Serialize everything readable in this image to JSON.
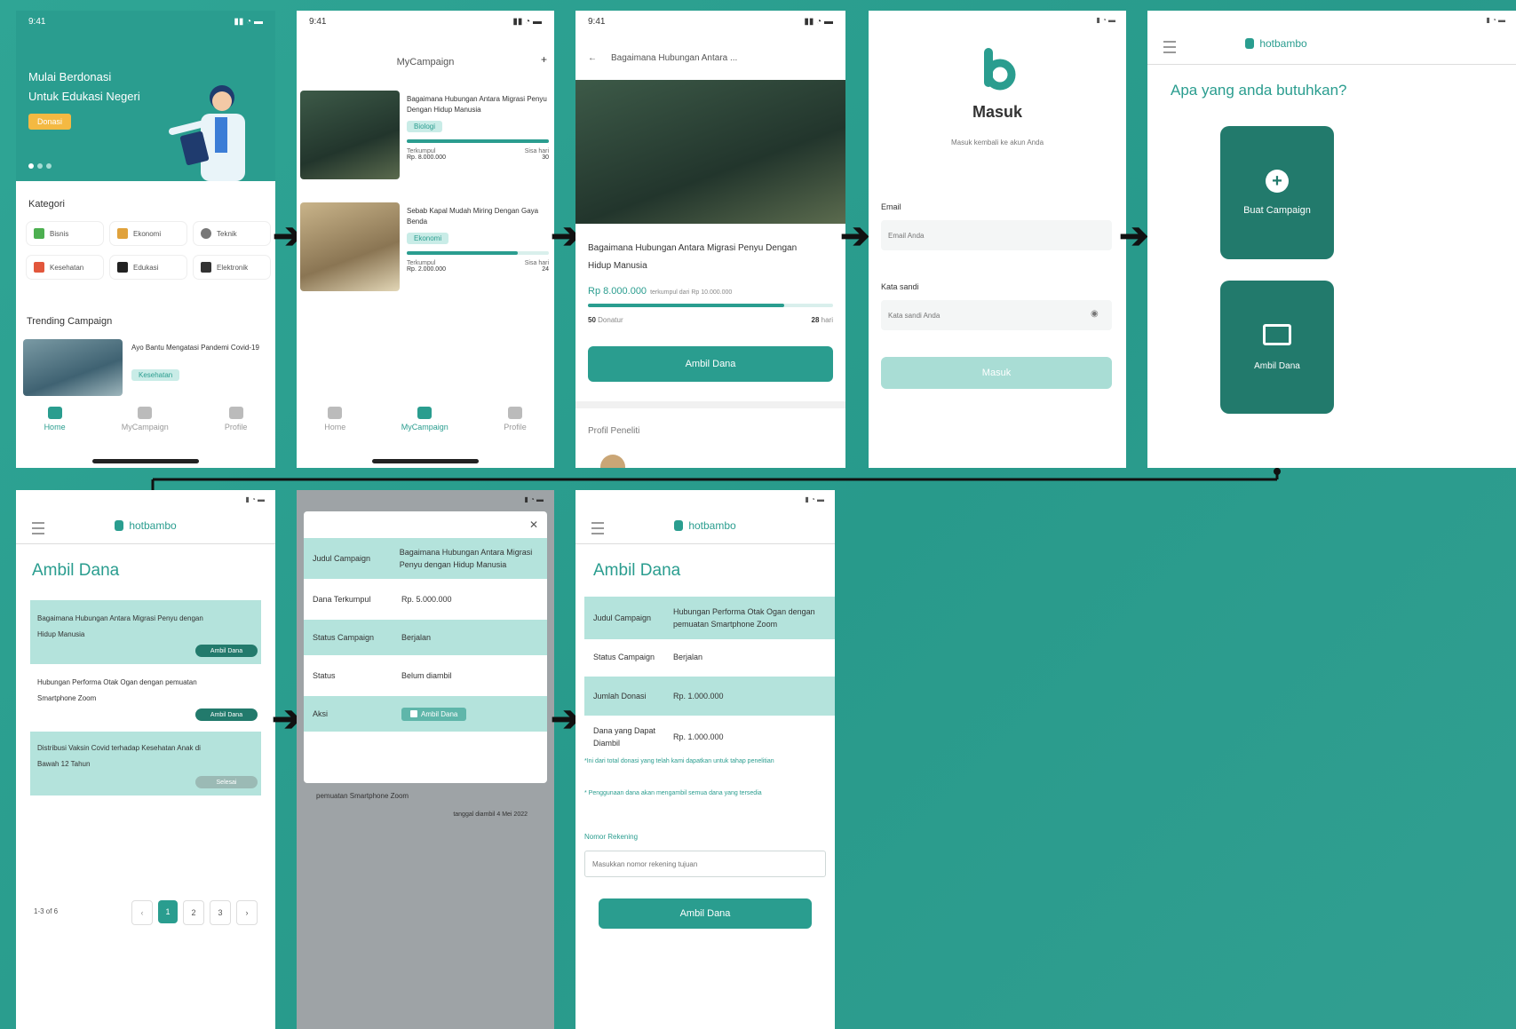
{
  "colors": {
    "primary": "#2a9d8f",
    "light": "#b4e3dc",
    "accent": "#f4b942",
    "bg": "#2a9d8f"
  },
  "s1": {
    "status_time": "9:41",
    "banner_title_1": "Mulai Berdonasi",
    "banner_title_2": "Untuk Edukasi Negeri",
    "banner_button": "Donasi",
    "kategori_title": "Kategori",
    "categories": [
      "Bisnis",
      "Ekonomi",
      "Teknik",
      "Kesehatan",
      "Edukasi",
      "Elektronik"
    ],
    "trending_title": "Trending Campaign",
    "trending_item": "Ayo Bantu Mengatasi Pandemi Covid-19",
    "trending_chip": "Kesehatan",
    "nav": [
      "Home",
      "MyCampaign",
      "Profile"
    ]
  },
  "s2": {
    "status_time": "9:41",
    "title": "MyCampaign",
    "campaigns": [
      {
        "title": "Bagaimana Hubungan Antara Migrasi Penyu Dengan Hidup Manusia",
        "chip": "Biologi",
        "raised_label": "Terkumpul",
        "raised": "Rp. 8.000.000",
        "days_label": "Sisa hari",
        "days": "30"
      },
      {
        "title": "Sebab Kapal Mudah Miring Dengan Gaya Benda",
        "chip": "Ekonomi",
        "raised_label": "Terkumpul",
        "raised": "Rp. 2.000.000",
        "days_label": "Sisa hari",
        "days": "24"
      }
    ],
    "nav": [
      "Home",
      "MyCampaign",
      "Profile"
    ]
  },
  "s3": {
    "status_time": "9:41",
    "header": "Bagaimana Hubungan Antara ...",
    "title": "Bagaimana Hubungan Antara Migrasi Penyu Dengan Hidup Manusia",
    "amount": "Rp 8.000.000",
    "target": "terkumpul dari Rp 10.000.000",
    "donatur_count": "50",
    "donatur_label": "Donatur",
    "days_count": "28",
    "days_label": "hari",
    "button": "Ambil Dana",
    "profile_title": "Profil Peneliti"
  },
  "s4": {
    "title": "Masuk",
    "subtitle": "Masuk kembali ke akun Anda",
    "email_label": "Email",
    "email_placeholder": "Email Anda",
    "password_label": "Kata sandi",
    "password_placeholder": "Kata sandi Anda",
    "button": "Masuk"
  },
  "s5": {
    "brand": "hotbambo",
    "question": "Apa yang anda butuhkan?",
    "card1": "Buat Campaign",
    "card2": "Ambil Dana"
  },
  "s6": {
    "brand": "hotbambo",
    "title": "Ambil Dana",
    "items": [
      {
        "title": "Bagaimana Hubungan Antara Migrasi Penyu dengan Hidup Manusia",
        "badge": "Ambil Dana"
      },
      {
        "title": "Hubungan Performa Otak Ogan dengan pemuatan Smartphone Zoom",
        "badge": "Ambil Dana"
      },
      {
        "title": "Distribusi Vaksin Covid terhadap Kesehatan Anak di Bawah 12 Tahun",
        "badge": "Selesai"
      }
    ],
    "pagination_label": "1-3 of 6",
    "pages": [
      "‹",
      "1",
      "2",
      "3",
      "›"
    ]
  },
  "s7": {
    "rows": [
      {
        "k": "Judul Campaign",
        "v": "Bagaimana Hubungan Antara Migrasi Penyu dengan Hidup Manusia"
      },
      {
        "k": "Dana Terkumpul",
        "v": "Rp. 5.000.000"
      },
      {
        "k": "Status Campaign",
        "v": "Berjalan"
      },
      {
        "k": "Status",
        "v": "Belum diambil"
      },
      {
        "k": "Aksi",
        "v": "Ambil Dana"
      }
    ],
    "behind_text": "pemuatan Smartphone Zoom",
    "behind_date": "tanggal diambil 4 Mei 2022"
  },
  "s8": {
    "brand": "hotbambo",
    "title": "Ambil Dana",
    "rows": [
      {
        "k": "Judul Campaign",
        "v": "Hubungan Performa Otak Ogan dengan pemuatan Smartphone Zoom"
      },
      {
        "k": "Status Campaign",
        "v": "Berjalan"
      },
      {
        "k": "Jumlah Donasi",
        "v": "Rp. 1.000.000"
      },
      {
        "k": "Dana yang Dapat Diambil",
        "v": "Rp. 1.000.000"
      }
    ],
    "note1": "*Ini dari total donasi yang telah kami dapatkan untuk tahap penelitian",
    "note2": "* Penggunaan dana akan mengambil semua dana yang tersedia",
    "field_label": "Nomor Rekening",
    "field_placeholder": "Masukkan nomor rekening tujuan",
    "button": "Ambil Dana"
  }
}
